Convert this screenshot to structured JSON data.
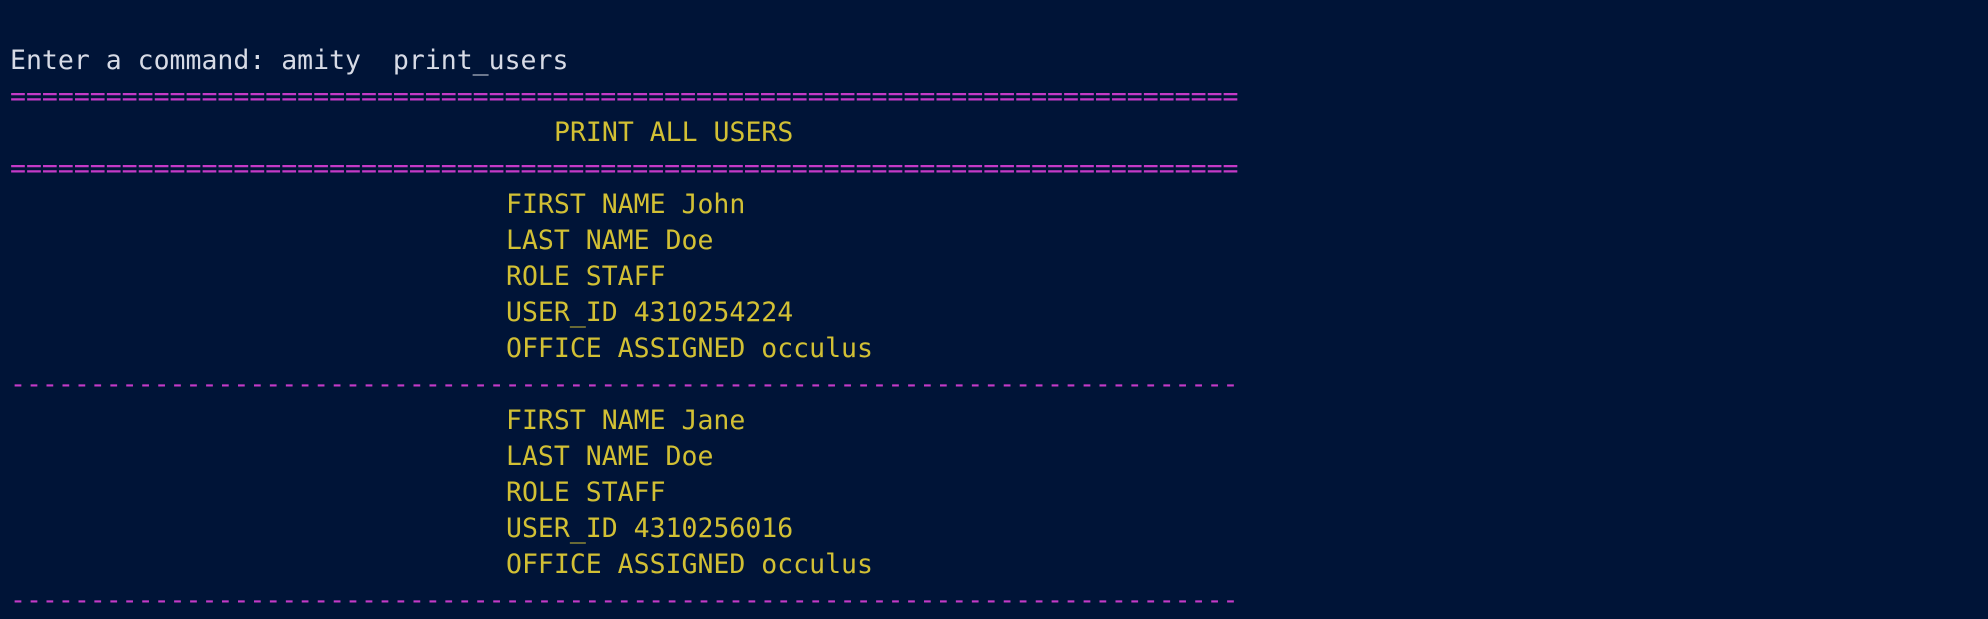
{
  "terminal": {
    "prompt": "Enter a command: amity  print_users",
    "double_rule": "=============================================================================",
    "title": "PRINT ALL USERS",
    "single_rule": "-----------------------------------------------------------------------------",
    "users": [
      {
        "first_name": "FIRST NAME John",
        "last_name": "LAST NAME Doe",
        "role": "ROLE STAFF",
        "user_id": "USER_ID 4310254224",
        "office": "OFFICE ASSIGNED occulus"
      },
      {
        "first_name": "FIRST NAME Jane",
        "last_name": "LAST NAME Doe",
        "role": "ROLE STAFF",
        "user_id": "USER_ID 4310256016",
        "office": "OFFICE ASSIGNED occulus"
      }
    ]
  },
  "colors": {
    "background": "#001437",
    "prompt_text": "#d7dbe6",
    "separator": "#c43ac7",
    "output_text": "#d2c034"
  }
}
